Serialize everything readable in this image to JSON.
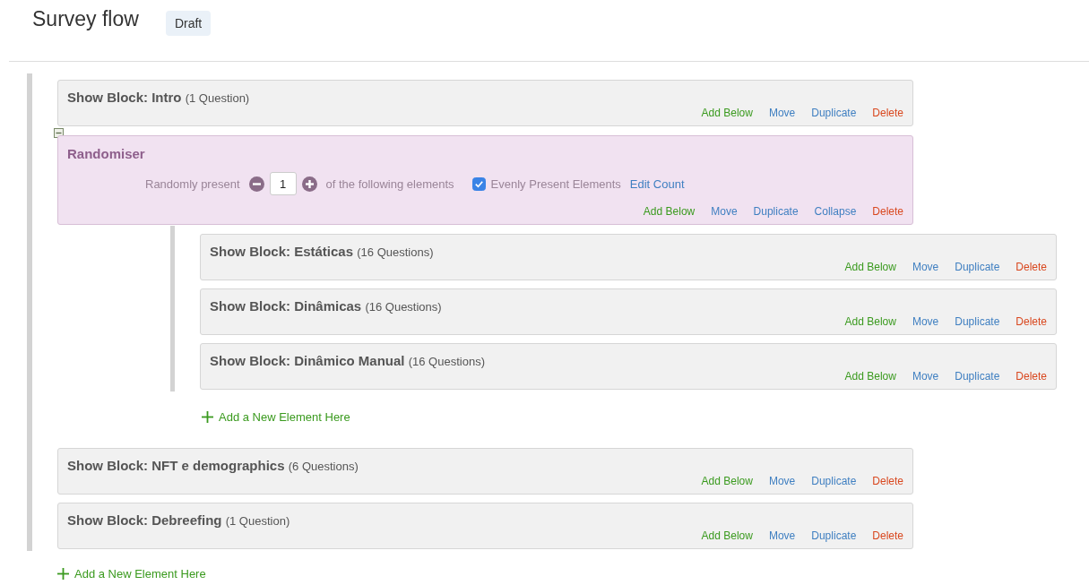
{
  "header": {
    "title": "Survey flow",
    "badge": "Draft"
  },
  "flow": [
    {
      "kind": "block",
      "title": "Show Block: Intro",
      "count": "(1 Question)",
      "actions": [
        {
          "label": "Add Below",
          "kind": "add"
        },
        {
          "label": "Move",
          "kind": "normal"
        },
        {
          "label": "Duplicate",
          "kind": "normal"
        },
        {
          "label": "Delete",
          "kind": "delete"
        }
      ]
    },
    {
      "kind": "randomiser",
      "expanded": true,
      "title": "Randomiser",
      "prefix": "Randomly present",
      "count_value": "1",
      "suffix": "of the following elements",
      "evenly": {
        "label": "Evenly Present Elements",
        "checked": true
      },
      "edit_link": "Edit Count",
      "actions": [
        {
          "label": "Add Below",
          "kind": "add"
        },
        {
          "label": "Move",
          "kind": "normal"
        },
        {
          "label": "Duplicate",
          "kind": "normal"
        },
        {
          "label": "Collapse",
          "kind": "normal"
        },
        {
          "label": "Delete",
          "kind": "delete"
        }
      ],
      "children": [
        {
          "kind": "block",
          "title": "Show Block: Estáticas",
          "count": "(16 Questions)",
          "actions": [
            {
              "label": "Add Below",
              "kind": "add"
            },
            {
              "label": "Move",
              "kind": "normal"
            },
            {
              "label": "Duplicate",
              "kind": "normal"
            },
            {
              "label": "Delete",
              "kind": "delete"
            }
          ]
        },
        {
          "kind": "block",
          "title": "Show Block: Dinâmicas",
          "count": "(16 Questions)",
          "actions": [
            {
              "label": "Add Below",
              "kind": "add"
            },
            {
              "label": "Move",
              "kind": "normal"
            },
            {
              "label": "Duplicate",
              "kind": "normal"
            },
            {
              "label": "Delete",
              "kind": "delete"
            }
          ]
        },
        {
          "kind": "block",
          "title": "Show Block: Dinâmico Manual",
          "count": "(16 Questions)",
          "actions": [
            {
              "label": "Add Below",
              "kind": "add"
            },
            {
              "label": "Move",
              "kind": "normal"
            },
            {
              "label": "Duplicate",
              "kind": "normal"
            },
            {
              "label": "Delete",
              "kind": "delete"
            }
          ]
        }
      ],
      "add_element": "Add a New Element Here"
    },
    {
      "kind": "block",
      "title": "Show Block: NFT e demographics",
      "count": "(6 Questions)",
      "actions": [
        {
          "label": "Add Below",
          "kind": "add"
        },
        {
          "label": "Move",
          "kind": "normal"
        },
        {
          "label": "Duplicate",
          "kind": "normal"
        },
        {
          "label": "Delete",
          "kind": "delete"
        }
      ]
    },
    {
      "kind": "block",
      "title": "Show Block: Debreefing",
      "count": "(1 Question)",
      "actions": [
        {
          "label": "Add Below",
          "kind": "add"
        },
        {
          "label": "Move",
          "kind": "normal"
        },
        {
          "label": "Duplicate",
          "kind": "normal"
        },
        {
          "label": "Delete",
          "kind": "delete"
        }
      ]
    }
  ],
  "add_element": "Add a New Element Here"
}
